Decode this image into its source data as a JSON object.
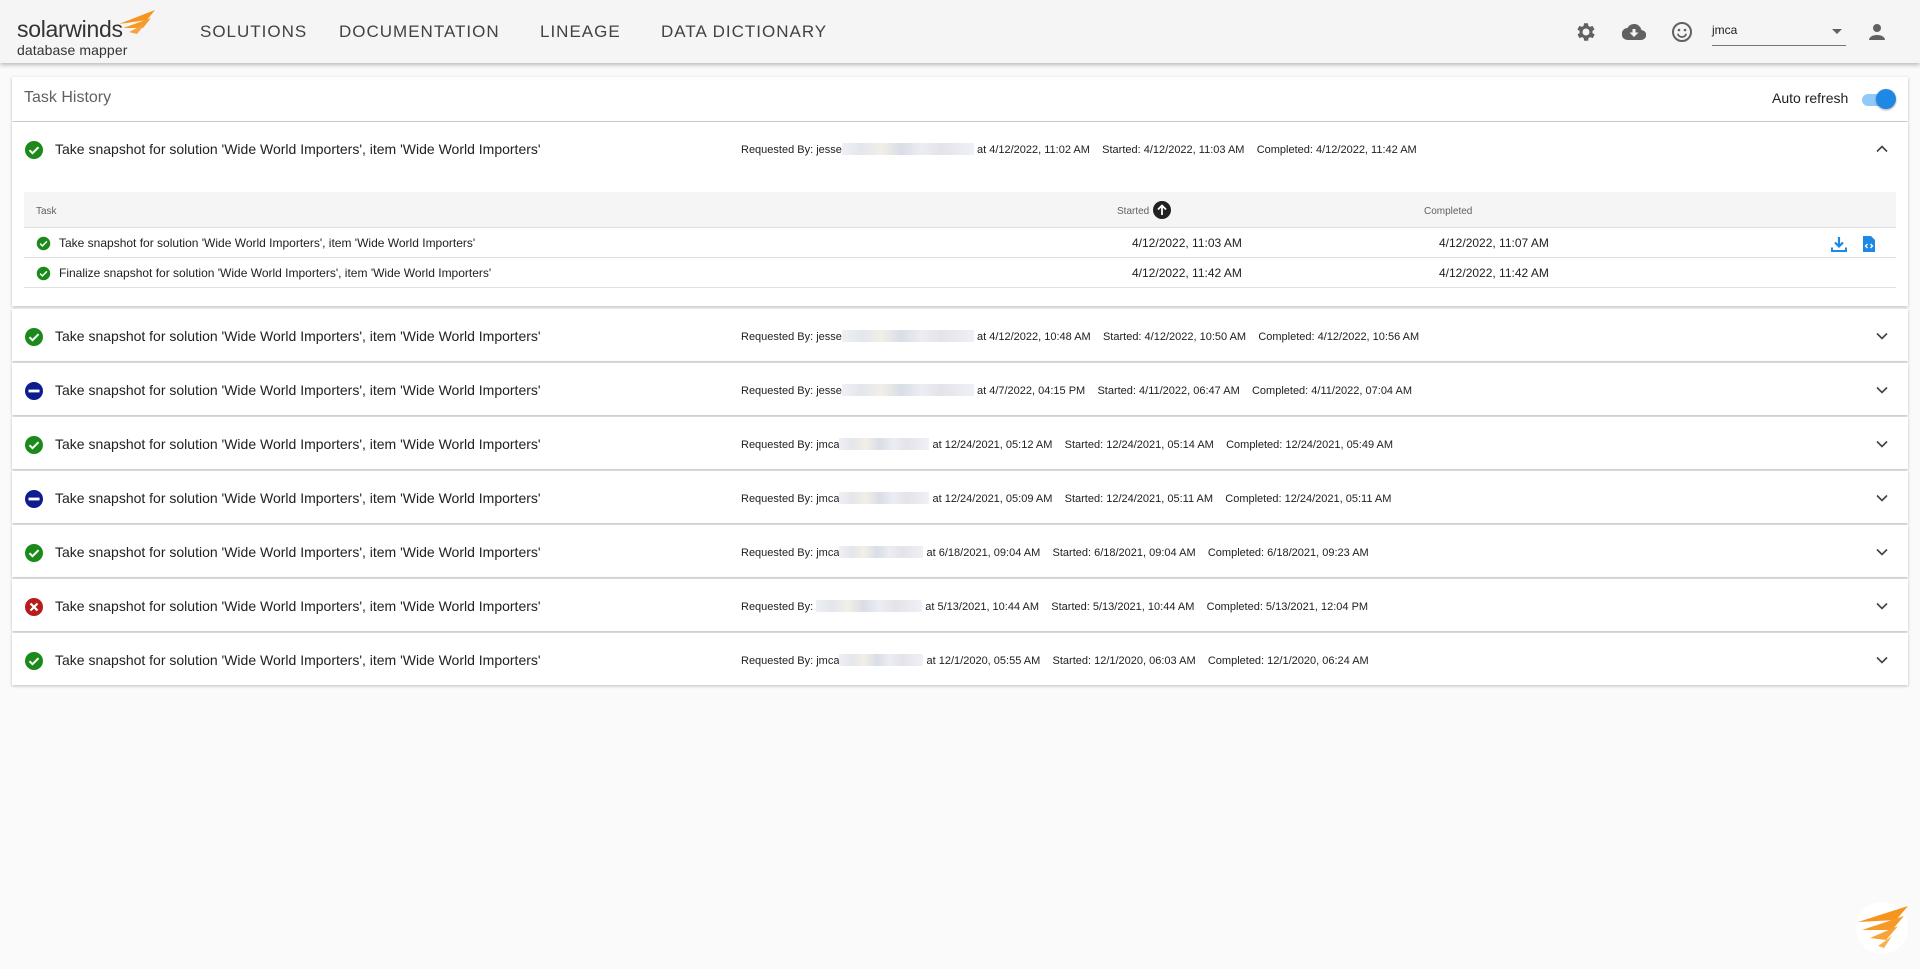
{
  "header": {
    "logo_main": "solarwinds",
    "logo_sub": "database mapper",
    "nav": [
      "SOLUTIONS",
      "DOCUMENTATION",
      "LINEAGE",
      "DATA DICTIONARY"
    ],
    "user": "jmca",
    "icons": [
      "settings-icon",
      "cloud-download-icon",
      "smiley-icon",
      "account-icon"
    ]
  },
  "page": {
    "title": "Task History",
    "auto_refresh_label": "Auto refresh",
    "auto_refresh_on": true
  },
  "columns": {
    "task": "Task",
    "started": "Started",
    "completed": "Completed"
  },
  "tasks": [
    {
      "status": "success",
      "title": "Take snapshot for solution 'Wide World Importers', item 'Wide World Importers'",
      "requested_label": "Requested By:",
      "requested_by": "jesse",
      "at": "at 4/12/2022, 11:02 AM",
      "started": "Started: 4/12/2022, 11:03 AM",
      "completed": "Completed: 4/12/2022, 11:42 AM",
      "expanded": true,
      "subtasks": [
        {
          "status": "success",
          "task": "Take snapshot for solution 'Wide World Importers', item 'Wide World Importers'",
          "started": "4/12/2022, 11:03 AM",
          "completed": "4/12/2022, 11:07 AM",
          "has_actions": true
        },
        {
          "status": "success",
          "task": "Finalize snapshot for solution 'Wide World Importers', item 'Wide World Importers'",
          "started": "4/12/2022, 11:42 AM",
          "completed": "4/12/2022, 11:42 AM",
          "has_actions": false
        }
      ]
    },
    {
      "status": "success",
      "title": "Take snapshot for solution 'Wide World Importers', item 'Wide World Importers'",
      "requested_label": "Requested By:",
      "requested_by": "jesse",
      "at": "at 4/12/2022, 10:48 AM",
      "started": "Started: 4/12/2022, 10:50 AM",
      "completed": "Completed: 4/12/2022, 10:56 AM"
    },
    {
      "status": "cancelled",
      "title": "Take snapshot for solution 'Wide World Importers', item 'Wide World Importers'",
      "requested_label": "Requested By:",
      "requested_by": "jesse",
      "at": "at 4/7/2022, 04:15 PM",
      "started": "Started: 4/11/2022, 06:47 AM",
      "completed": "Completed: 4/11/2022, 07:04 AM"
    },
    {
      "status": "success",
      "title": "Take snapshot for solution 'Wide World Importers', item 'Wide World Importers'",
      "requested_label": "Requested By:",
      "requested_by": "jmca",
      "at": "at 12/24/2021, 05:12 AM",
      "started": "Started: 12/24/2021, 05:14 AM",
      "completed": "Completed: 12/24/2021, 05:49 AM"
    },
    {
      "status": "cancelled",
      "title": "Take snapshot for solution 'Wide World Importers', item 'Wide World Importers'",
      "requested_label": "Requested By:",
      "requested_by": "jmca",
      "at": "at 12/24/2021, 05:09 AM",
      "started": "Started: 12/24/2021, 05:11 AM",
      "completed": "Completed: 12/24/2021, 05:11 AM"
    },
    {
      "status": "success",
      "title": "Take snapshot for solution 'Wide World Importers', item 'Wide World Importers'",
      "requested_label": "Requested By:",
      "requested_by": "jmca",
      "at": "at 6/18/2021, 09:04 AM",
      "started": "Started: 6/18/2021, 09:04 AM",
      "completed": "Completed: 6/18/2021, 09:23 AM"
    },
    {
      "status": "failed",
      "title": "Take snapshot for solution 'Wide World Importers', item 'Wide World Importers'",
      "requested_label": "Requested By:",
      "requested_by": "",
      "at": "at 5/13/2021, 10:44 AM",
      "started": "Started: 5/13/2021, 10:44 AM",
      "completed": "Completed: 5/13/2021, 12:04 PM"
    },
    {
      "status": "success",
      "title": "Take snapshot for solution 'Wide World Importers', item 'Wide World Importers'",
      "requested_label": "Requested By:",
      "requested_by": "jmca",
      "at": "at 12/1/2020, 05:55 AM",
      "started": "Started: 12/1/2020, 06:03 AM",
      "completed": "Completed: 12/1/2020, 06:24 AM"
    }
  ],
  "colors": {
    "success": "#1b8a1b",
    "cancelled": "#0d1c8f",
    "failed": "#b71c1c",
    "accent": "#1e88e5",
    "brand": "#f7941d"
  }
}
